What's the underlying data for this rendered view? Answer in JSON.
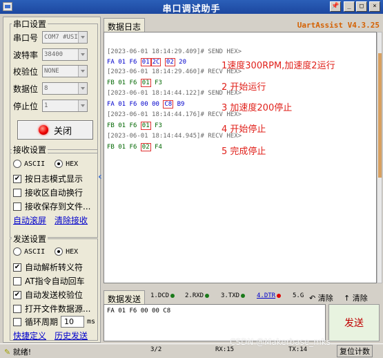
{
  "window": {
    "title": "串口调试助手",
    "btn_pin": "📌",
    "btn_min": "_",
    "btn_max": "□",
    "btn_close": "×"
  },
  "port_settings": {
    "title": "串口设置",
    "port_label": "串口号",
    "port_value": "COM7 #USI",
    "baud_label": "波特率",
    "baud_value": "38400",
    "parity_label": "校验位",
    "parity_value": "NONE",
    "data_label": "数据位",
    "data_value": "8",
    "stop_label": "停止位",
    "stop_value": "1",
    "close_button": "关闭"
  },
  "recv_settings": {
    "title": "接收设置",
    "ascii": "ASCII",
    "hex": "HEX",
    "opt_log_mode": "按日志模式显示",
    "opt_auto_wrap": "接收区自动换行",
    "opt_save_file": "接收保存到文件...",
    "link_autoscroll": "自动滚屏",
    "link_clear": "清除接收"
  },
  "send_settings": {
    "title": "发送设置",
    "ascii": "ASCII",
    "hex": "HEX",
    "opt_escape": "自动解析转义符",
    "opt_at": "AT指令自动回车",
    "opt_checksum": "自动发送校验位",
    "opt_file": "打开文件数据源...",
    "opt_loop": "循环周期",
    "loop_value": "10",
    "loop_unit": "ms",
    "link_shortcut": "快捷定义",
    "link_history": "历史发送"
  },
  "log": {
    "tab": "数据日志",
    "brand": "UartAssist V4.3.25",
    "entries": [
      {
        "ts": "[2023-06-01 18:14:29.409]# SEND HEX>",
        "data": [
          "FA",
          "01",
          "F6",
          "01",
          "2C",
          "02",
          "20"
        ],
        "annotation": "1速度300RPM,加速度2运行"
      },
      {
        "ts": "[2023-06-01 18:14:29.460]# RECV HEX>",
        "data": [
          "FB",
          "01",
          "F6",
          "01",
          "F3"
        ],
        "annotation": "2 开始运行"
      },
      {
        "ts": "[2023-06-01 18:14:44.122]# SEND HEX>",
        "data": [
          "FA",
          "01",
          "F6",
          "00",
          "00",
          "C8",
          "B9"
        ],
        "annotation": "3 加速度200停止"
      },
      {
        "ts": "[2023-06-01 18:14:44.176]# RECV HEX>",
        "data": [
          "FB",
          "01",
          "F6",
          "01",
          "F3"
        ],
        "annotation": "4  开始停止"
      },
      {
        "ts": "[2023-06-01 18:14:44.945]# RECV HEX>",
        "data": [
          "FB",
          "01",
          "F6",
          "02",
          "F4"
        ],
        "annotation": "5  完成停止"
      }
    ]
  },
  "send_area": {
    "tab": "数据发送",
    "sig_dcd": "1.DCD",
    "sig_rxd": "2.RXD",
    "sig_txd": "3.TXD",
    "sig_dtr": "4.DTR",
    "sig_g": "5.G",
    "clear1": "清除",
    "clear2": "清除",
    "content": "FA 01 F6 00 00 C8",
    "send_button": "发送"
  },
  "status": {
    "ready": "就绪!",
    "frames": "3/2",
    "rx": "RX:15",
    "tx": "TX:14",
    "reset": "复位计数"
  },
  "watermark": "CSDN @Makerbase_mks",
  "colors": {
    "send_text": "#0000cc",
    "recv_text": "#006600",
    "annotation": "#e0201a",
    "highlight_box": "#e03030"
  }
}
